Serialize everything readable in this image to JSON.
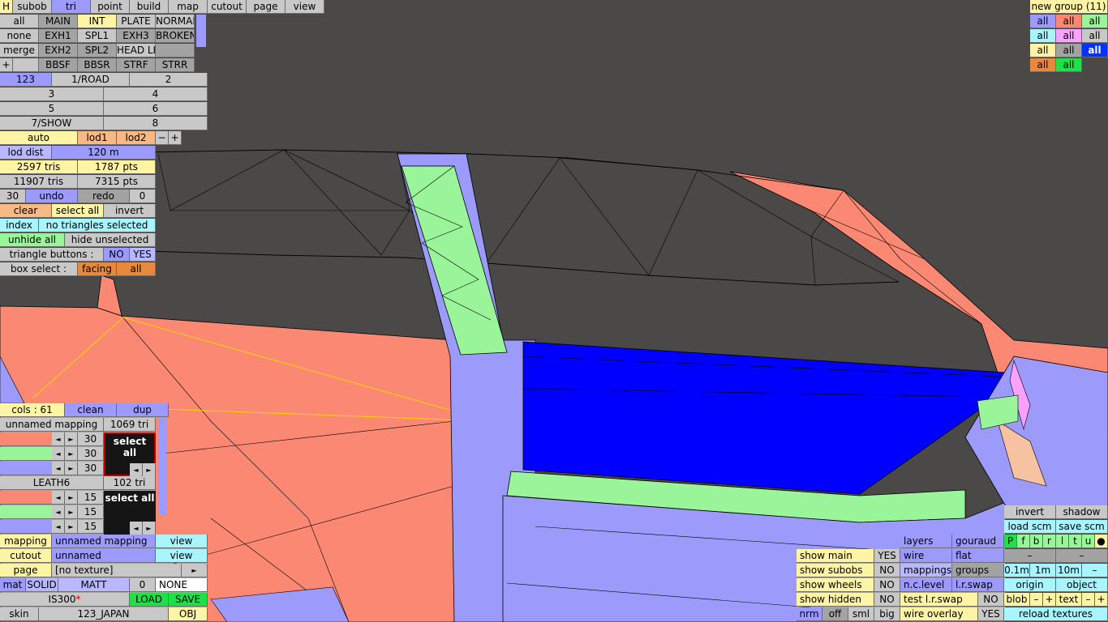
{
  "menu": [
    "H",
    "subob",
    "tri",
    "point",
    "build",
    "map",
    "cutout",
    "page",
    "view"
  ],
  "groups_grid": [
    [
      "all",
      "MAIN",
      "INT",
      "PLATE",
      "NORMAL"
    ],
    [
      "none",
      "EXH1",
      "SPL1",
      "EXH3",
      "BROKEN"
    ],
    [
      "merge",
      "EXH2",
      "SPL2",
      "HEAD LI",
      ""
    ],
    [
      "+",
      "",
      "BBSF",
      "BBSR",
      "STRF",
      "STRR"
    ]
  ],
  "views": {
    "r1": [
      "123",
      "1/ROAD",
      "2"
    ],
    "r2": [
      "3",
      "4"
    ],
    "r3": [
      "5",
      "6"
    ],
    "r4": [
      "7/SHOW",
      "8"
    ]
  },
  "lod": {
    "auto": "auto",
    "lod1": "lod1",
    "lod2": "lod2",
    "minus": "−",
    "plus": "+",
    "dist_label": "lod dist",
    "dist_value": "120 m"
  },
  "stats": {
    "tris": "2597 tris",
    "pts": "1787 pts",
    "tris_total": "11907 tris",
    "pts_total": "7315 pts"
  },
  "history": {
    "count": "30",
    "undo": "undo",
    "redo": "redo",
    "redo_count": "0"
  },
  "selection": {
    "clear": "clear",
    "select_all": "select all",
    "invert": "invert",
    "index_label": "index",
    "status": "no triangles selected",
    "unhide_all": "unhide all",
    "hide_unselected": "hide unselected",
    "tri_buttons_label": "triangle buttons :",
    "no": "NO",
    "yes": "YES",
    "box_select_label": "box select :",
    "facing": "facing",
    "all": "all"
  },
  "cols": {
    "label": "cols : 61",
    "clean": "clean",
    "dup": "dup"
  },
  "mapping1": {
    "name": "unnamed mapping",
    "tris": "1069 tri",
    "values": [
      "30",
      "30",
      "30"
    ],
    "select_all": "select all"
  },
  "mapping2": {
    "name": "LEATH6",
    "tris": "102 tri",
    "values": [
      "15",
      "15",
      "15"
    ],
    "select_all": "select all"
  },
  "arrows": {
    "left": "◄",
    "right": "►"
  },
  "bottom_left": {
    "mapping_label": "mapping",
    "mapping_value": "unnamed mapping",
    "view": "view",
    "cutout_label": "cutout",
    "cutout_value": "unnamed",
    "page_label": "page",
    "page_value": "[no texture]",
    "page_arrow": "►",
    "mat_label": "mat",
    "solid": "SOLID",
    "matt": "MATT",
    "mat_num": "0",
    "none": "NONE",
    "model": "IS300",
    "model_flag": "*",
    "load": "LOAD",
    "save": "SAVE",
    "skin_label": "skin",
    "skin_value": "123_JAPAN",
    "obj": "OBJ"
  },
  "top_right": {
    "title": "new group (11)",
    "cells": [
      "all",
      "all",
      "all",
      "all",
      "all",
      "all",
      "all",
      "all",
      "all",
      "all",
      "all"
    ]
  },
  "bottom_right": {
    "show_main": "show main",
    "show_subobs": "show subobs",
    "show_wheels": "show wheels",
    "show_hidden": "show hidden",
    "yes": "YES",
    "no": "NO",
    "layers": "layers",
    "gouraud": "gouraud",
    "wire": "wire",
    "flat": "flat",
    "mappings": "mappings",
    "groups": "groups",
    "nclevel": "n.c.level",
    "lrswap": "l.r.swap",
    "test_lrswap": "test l.r.swap",
    "wire_overlay": "wire overlay",
    "nrm": "nrm",
    "off": "off",
    "sml": "sml",
    "big": "big",
    "invert": "invert",
    "shadow": "shadow",
    "load_scm": "load scm",
    "save_scm": "save scm",
    "flags": [
      "P",
      "f",
      "b",
      "r",
      "l",
      "t",
      "u",
      "●"
    ],
    "dash": "–",
    "d01": "0.1m",
    "d1": "1m",
    "d10": "10m",
    "dminus": "–",
    "origin": "origin",
    "object": "object",
    "blob": "blob",
    "minus": "–",
    "plus": "+",
    "text": "text",
    "reload": "reload textures"
  },
  "colors": {
    "background": "#4b4848",
    "salmon": "#fa8872",
    "lavender": "#9c9bfb",
    "lightgreen": "#9af59a",
    "blue": "#0000ff",
    "yellow_button": "#fdf5a5",
    "orange_button": "#f7b985"
  }
}
